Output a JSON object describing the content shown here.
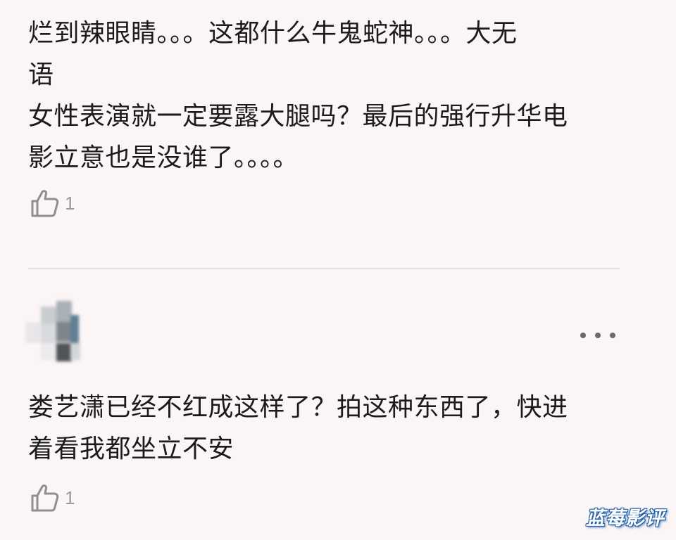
{
  "comments": [
    {
      "text": "烂到辣眼睛。。。这都什么牛鬼蛇神。。。大无\n语\n女性表演就一定要露大腿吗？最后的强行升华电\n影立意也是没谁了。。。。",
      "like_icon": "thumbs-up-icon",
      "like_count": "1"
    },
    {
      "author_name": "",
      "meta": "",
      "text": "娄艺潇已经不红成这样了？拍这种东西了，快进\n着看我都坐立不安",
      "like_icon": "thumbs-up-icon",
      "like_count": "1",
      "more_icon": "more-horizontal-icon"
    }
  ],
  "watermark": "蓝莓影评",
  "colors": {
    "background": "#fbf5f6",
    "text": "#1b1b1b",
    "secondary": "#9a9a9a",
    "watermark_outline": "#1e5fa8"
  }
}
